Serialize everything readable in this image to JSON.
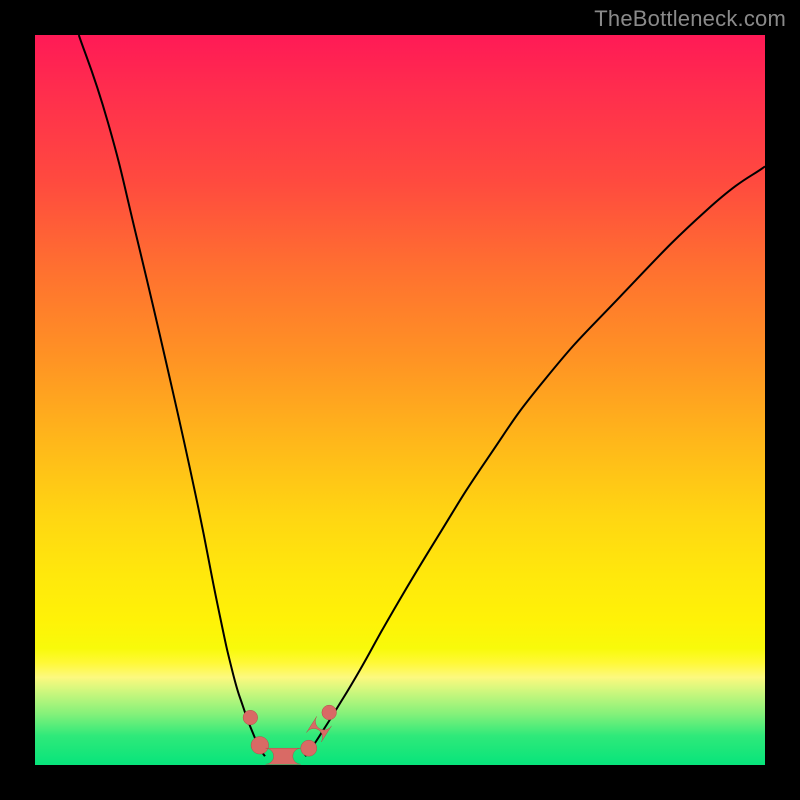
{
  "domain": "Chart",
  "watermark": "TheBottleneck.com",
  "colors": {
    "background": "#000000",
    "gradient_top": "#ff1a56",
    "gradient_mid": "#ffe80c",
    "gradient_bottom": "#07e47b",
    "curve": "#000000",
    "marker": "#d96a65"
  },
  "chart_data": {
    "type": "line",
    "title": "",
    "xlabel": "",
    "ylabel": "",
    "xlim": [
      0,
      100
    ],
    "ylim": [
      0,
      100
    ],
    "grid": false,
    "legend": false,
    "series": [
      {
        "name": "left-curve",
        "x": [
          6,
          10,
          14,
          18,
          22,
          25,
          27,
          28.5,
          29.8,
          30.8,
          31.5
        ],
        "y": [
          100,
          88,
          72,
          55,
          37,
          22,
          13,
          8,
          4.5,
          2.3,
          1.2
        ]
      },
      {
        "name": "right-curve",
        "x": [
          37,
          38,
          39.5,
          41.5,
          44.5,
          49,
          55,
          62,
          70,
          80,
          92,
          100
        ],
        "y": [
          1.2,
          2.5,
          4.8,
          8,
          13,
          21,
          31,
          42,
          53,
          64,
          76,
          82
        ]
      }
    ],
    "markers": [
      {
        "shape": "circle",
        "x": 29.5,
        "y": 6.5,
        "r": 1.0
      },
      {
        "shape": "circle",
        "x": 30.8,
        "y": 2.7,
        "r": 1.2
      },
      {
        "shape": "pill",
        "x0": 31.6,
        "y0": 1.2,
        "x1": 36.4,
        "y1": 1.2,
        "r": 1.1
      },
      {
        "shape": "circle",
        "x": 37.5,
        "y": 2.3,
        "r": 1.1
      },
      {
        "shape": "pill",
        "x0": 38.2,
        "y0": 3.8,
        "x1": 39.6,
        "y1": 6.0,
        "r": 1.2
      },
      {
        "shape": "circle",
        "x": 40.3,
        "y": 7.2,
        "r": 1.0
      }
    ]
  }
}
